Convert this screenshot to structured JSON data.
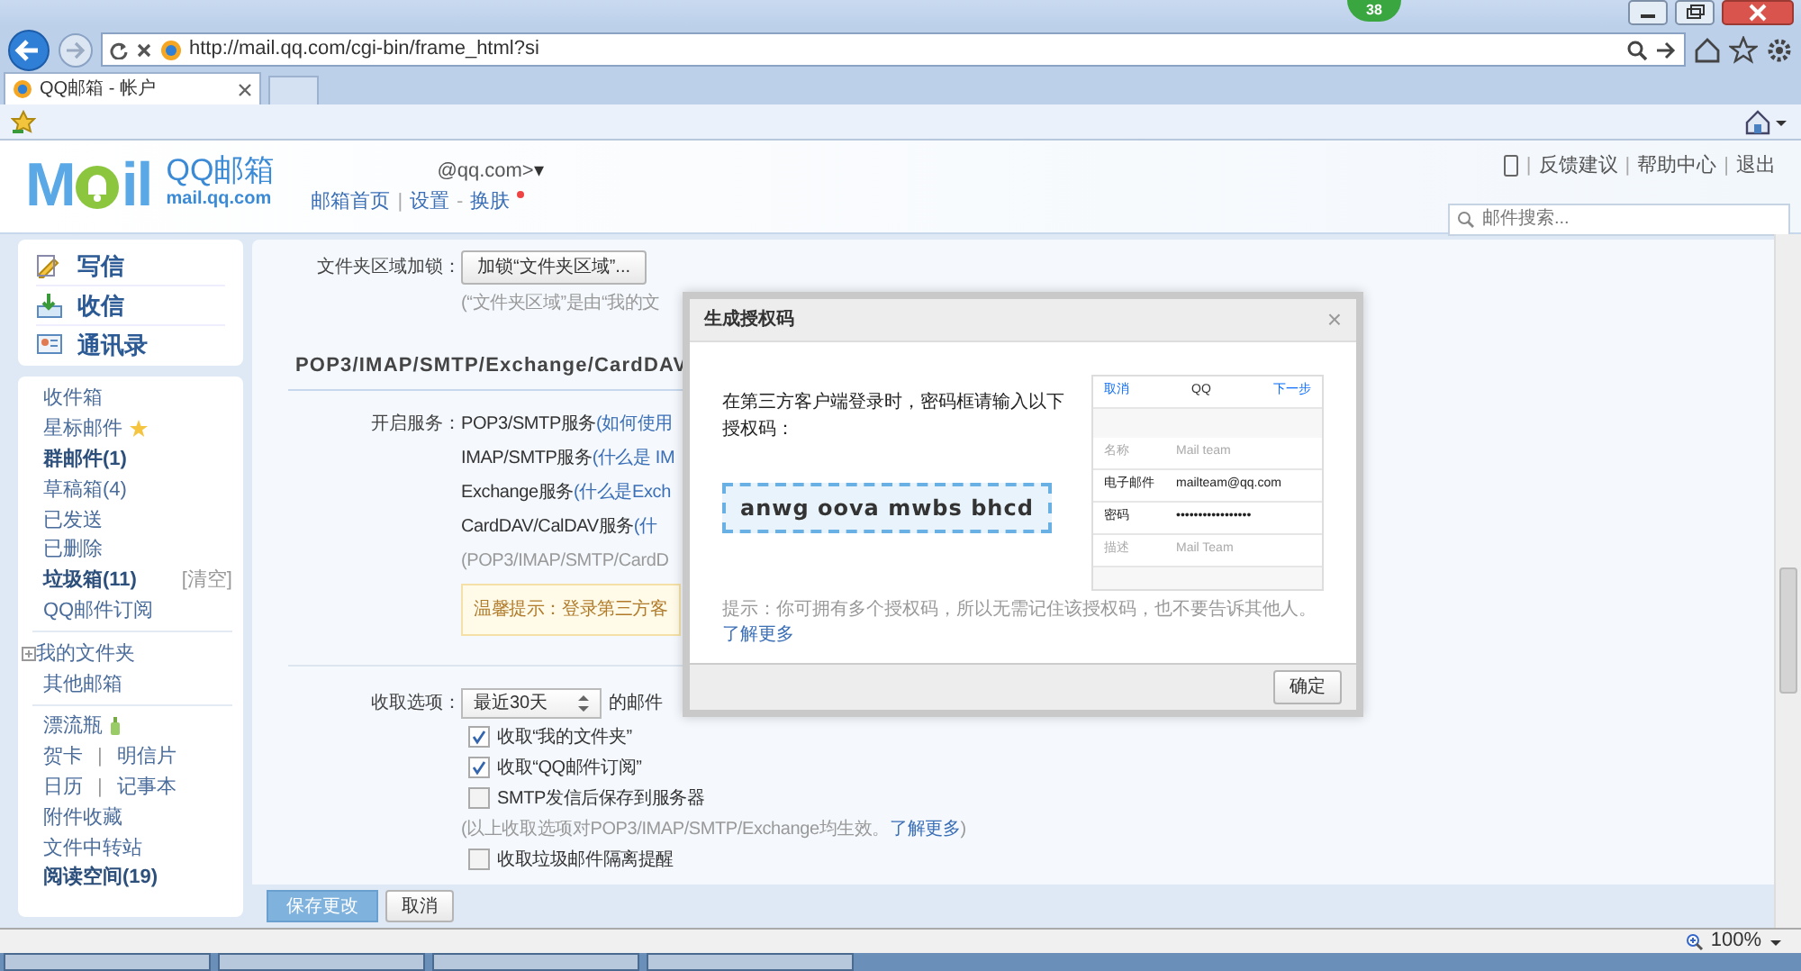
{
  "browser": {
    "badge": "38",
    "address": "http://mail.qq.com/cgi-bin/frame_html?si",
    "tab_title": "QQ邮箱 - 帐户",
    "zoom": "100%"
  },
  "header": {
    "logo_left": "M",
    "logo_right": "il",
    "brand": "QQ邮箱",
    "domain": "mail.qq.com",
    "account": "@qq.com>",
    "account_caret": "▾",
    "links": [
      {
        "text": "邮箱首页"
      },
      {
        "sep": "|",
        "text": "设置"
      },
      {
        "sep": "-",
        "text": "换肤"
      }
    ],
    "top_links": [
      {
        "sep": "|",
        "text": "反馈建议"
      },
      {
        "sep": "|",
        "text": "帮助中心"
      },
      {
        "sep": "|",
        "text": "退出"
      }
    ],
    "search": {
      "placeholder": "邮件搜索..."
    }
  },
  "sidebar": {
    "actions": [
      "写信",
      "收信",
      "通讯录"
    ],
    "groups": [
      [
        {
          "kind": "folder",
          "label": "收件箱",
          "unread": false
        },
        {
          "kind": "starred",
          "label": "星标邮件",
          "unread": false
        },
        {
          "kind": "folder",
          "label": "群邮件(1)",
          "unread": true
        },
        {
          "kind": "folder",
          "label": "草稿箱(4)",
          "unread": false
        },
        {
          "kind": "folder",
          "label": "已发送",
          "unread": false
        },
        {
          "kind": "folder",
          "label": "已删除",
          "unread": false
        },
        {
          "kind": "folder",
          "label": "垃圾箱(11)",
          "unread": true,
          "action": "[清空]"
        },
        {
          "kind": "folder",
          "label": "QQ邮件订阅",
          "unread": false
        }
      ],
      [
        {
          "kind": "tree",
          "label": "我的文件夹",
          "unread": false
        },
        {
          "kind": "folder",
          "label": "其他邮箱",
          "unread": false
        }
      ],
      [
        {
          "kind": "bottle",
          "label": "漂流瓶",
          "unread": false
        },
        {
          "kind": "pair",
          "labels": [
            "贺卡",
            "明信片"
          ],
          "separator": "|"
        },
        {
          "kind": "pair",
          "labels": [
            "日历",
            "记事本"
          ],
          "separator": "|"
        },
        {
          "kind": "folder",
          "label": "附件收藏",
          "unread": false
        },
        {
          "kind": "folder",
          "label": "文件中转站",
          "unread": false
        },
        {
          "kind": "folder",
          "label": "阅读空间(19)",
          "unread": true
        }
      ]
    ]
  },
  "main": {
    "lock": {
      "label": "文件夹区域加锁：",
      "button": "加锁“文件夹区域”...",
      "note": "(“文件夹区域”是由“我的文"
    },
    "section_title": "POP3/IMAP/SMTP/Exchange/CardDAV",
    "services": {
      "label": "开启服务：",
      "items": [
        {
          "name": "POP3/SMTP服务",
          "link": "(如何使用"
        },
        {
          "name": "IMAP/SMTP服务",
          "link": "(什么是 IM"
        },
        {
          "name": "Exchange服务",
          "link": "(什么是Exch"
        },
        {
          "name": "CardDAV/CalDAV服务",
          "link": "(什"
        }
      ],
      "note": "(POP3/IMAP/SMTP/CardD",
      "tip": "温馨提示：登录第三方客"
    },
    "fetch": {
      "label": "收取选项：",
      "select": "最近30天",
      "suffix": "的邮件",
      "options": [
        {
          "kind": "checkbox",
          "label": "收取“我的文件夹”",
          "checked": true
        },
        {
          "kind": "checkbox",
          "label": "收取“QQ邮件订阅”",
          "checked": true
        },
        {
          "kind": "checkbox",
          "label": "SMTP发信后保存到服务器",
          "checked": false
        },
        {
          "kind": "note",
          "label": "(以上收取选项对POP3/IMAP/SMTP/Exchange均生效。",
          "link": "了解更多",
          "end": ")"
        },
        {
          "kind": "checkbox",
          "label": "收取垃圾邮件隔离提醒",
          "checked": false
        }
      ]
    },
    "footer_buttons": [
      {
        "label": "保存更改",
        "primary": true
      },
      {
        "label": "取消",
        "primary": false
      }
    ]
  },
  "dialog": {
    "title": "生成授权码",
    "close": "×",
    "instruction": "在第三方客户端登录时，密码框请输入以下授权码：",
    "code": "anwg oova mwbs bhcd",
    "phone": {
      "cancel": "取消",
      "title": "QQ",
      "next": "下一步",
      "rows": [
        {
          "label": "名称",
          "value": "Mail team",
          "filled": false
        },
        {
          "label": "电子邮件",
          "value": "mailteam@qq.com",
          "filled": true
        },
        {
          "label": "密码",
          "value": "•••••••••••••••••",
          "filled": true
        },
        {
          "label": "描述",
          "value": "Mail Team",
          "filled": false
        }
      ]
    },
    "tip": "提示：你可拥有多个授权码，所以无需记住该授权码，也不要告诉其他人。",
    "tip_link": "了解更多",
    "ok": "确定"
  }
}
